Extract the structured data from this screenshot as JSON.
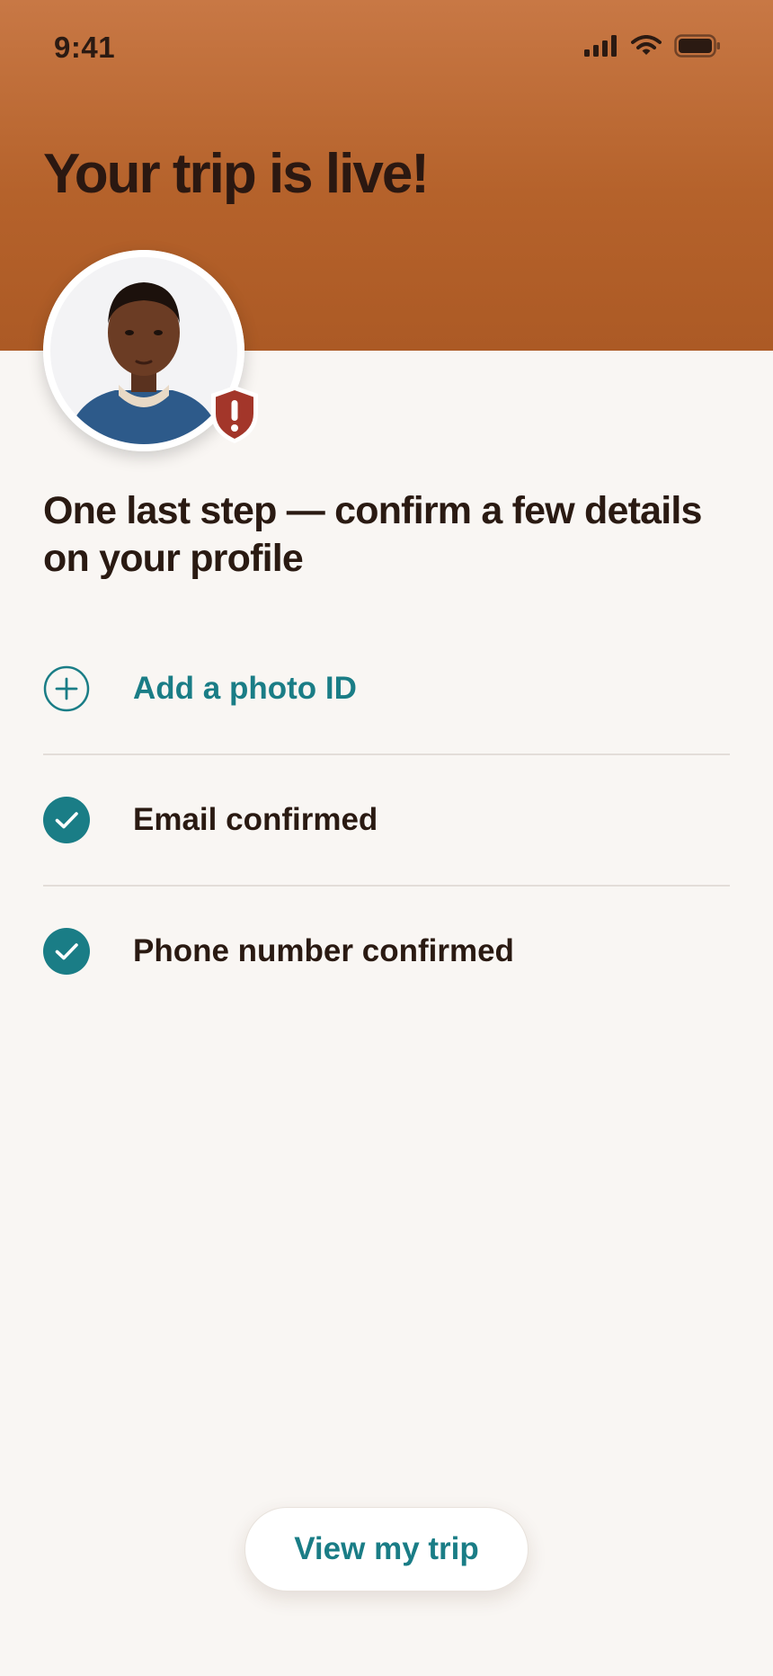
{
  "status_bar": {
    "time": "9:41",
    "icons": [
      "signal-icon",
      "wifi-icon",
      "battery-icon"
    ]
  },
  "header": {
    "title": "Your trip is live!"
  },
  "profile": {
    "avatar": "profile-photo",
    "badge_icon": "shield-alert-icon"
  },
  "subtitle": "One last step — confirm a few details on your profile",
  "checklist": [
    {
      "icon": "plus-circle-icon",
      "label": "Add a photo ID",
      "state": "todo"
    },
    {
      "icon": "check-circle-icon",
      "label": "Email confirmed",
      "state": "done"
    },
    {
      "icon": "check-circle-icon",
      "label": "Phone number confirmed",
      "state": "done"
    }
  ],
  "actions": {
    "primary_label": "View my trip"
  },
  "colors": {
    "header_top": "#c87845",
    "header_bottom": "#ac5a25",
    "accent_teal": "#1a7d86",
    "alert_red": "#a3362a",
    "background": "#f9f6f3",
    "text_dark": "#2a1a12"
  }
}
